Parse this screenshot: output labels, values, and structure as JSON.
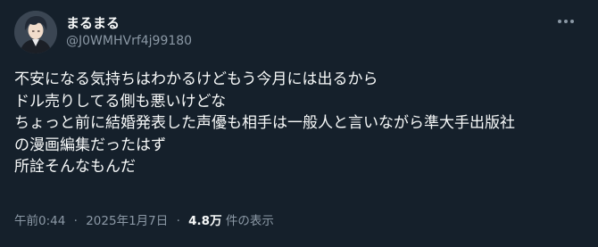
{
  "author": {
    "display_name": "まるまる",
    "handle": "@J0WMHVrf4j99180",
    "avatar_icon": "anime-avatar-icon"
  },
  "more_icon": "more-options-icon",
  "tweet": {
    "lines": [
      "不安になる気持ちはわかるけどもう今月には出るから",
      "ドル売りしてる側も悪いけどな",
      "ちょっと前に結婚発表した声優も相手は一般人と言いながら準大手出版社",
      "の漫画編集だったはず",
      "所詮そんなもんだ"
    ]
  },
  "meta": {
    "time": "午前0:44",
    "separator": "·",
    "date": "2025年1月7日",
    "views_count": "4.8万",
    "views_label": "件の表示"
  },
  "colors": {
    "background": "#15202b",
    "text_primary": "#f7f9f9",
    "text_secondary": "#8b98a5"
  }
}
